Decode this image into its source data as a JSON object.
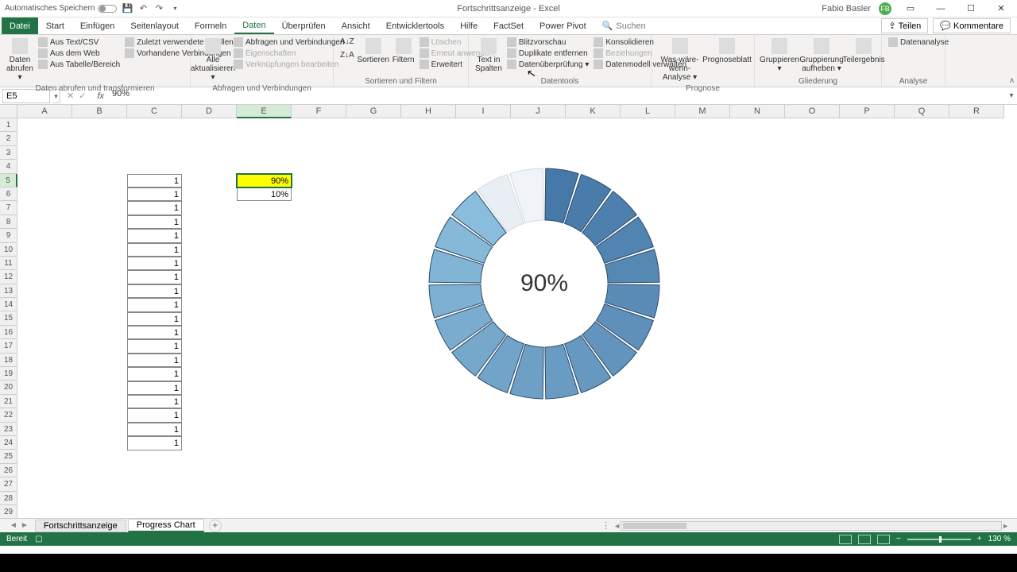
{
  "app": {
    "autosave_label": "Automatisches Speichern",
    "title": "Fortschrittsanzeige  -  Excel",
    "user_name": "Fabio Basler",
    "user_initials": "FB"
  },
  "tabs": {
    "file": "Datei",
    "items": [
      "Start",
      "Einfügen",
      "Seitenlayout",
      "Formeln",
      "Daten",
      "Überprüfen",
      "Ansicht",
      "Entwicklertools",
      "Hilfe",
      "FactSet",
      "Power Pivot"
    ],
    "active": "Daten",
    "search_placeholder": "Suchen",
    "share": "Teilen",
    "comments": "Kommentare"
  },
  "ribbon": {
    "g1": {
      "big": "Daten abrufen ▾",
      "items": [
        "Aus Text/CSV",
        "Aus dem Web",
        "Aus Tabelle/Bereich",
        "Zuletzt verwendete Quellen",
        "Vorhandene Verbindungen"
      ],
      "label": "Daten abrufen und transformieren"
    },
    "g2": {
      "big": "Alle aktualisieren ▾",
      "items": [
        "Abfragen und Verbindungen",
        "Eigenschaften",
        "Verknüpfungen bearbeiten"
      ],
      "label": "Abfragen und Verbindungen"
    },
    "g3": {
      "sortAZ": "A↓Z",
      "sortZA": "Z↓A",
      "sort": "Sortieren",
      "filter": "Filtern",
      "items": [
        "Löschen",
        "Erneut anwenden",
        "Erweitert"
      ],
      "label": "Sortieren und Filtern"
    },
    "g4": {
      "big": "Text in Spalten",
      "items": [
        "Blitzvorschau",
        "Duplikate entfernen",
        "Datenüberprüfung ▾",
        "Konsolidieren",
        "Beziehungen",
        "Datenmodell verwalten"
      ],
      "label": "Datentools"
    },
    "g5": {
      "big1": "Was-wäre-wenn-Analyse ▾",
      "big2": "Prognoseblatt",
      "label": "Prognose"
    },
    "g6": {
      "big1": "Gruppieren ▾",
      "big2": "Gruppierung aufheben ▾",
      "big3": "Teilergebnis",
      "label": "Gliederung"
    },
    "g7": {
      "item": "Datenanalyse",
      "label": "Analyse"
    }
  },
  "namebox": "E5",
  "formula": "90%",
  "columns": [
    "A",
    "B",
    "C",
    "D",
    "E",
    "F",
    "G",
    "H",
    "I",
    "J",
    "K",
    "L",
    "M",
    "N",
    "O",
    "P",
    "Q",
    "R"
  ],
  "rows": 29,
  "selected": {
    "col": "E",
    "row": 5
  },
  "data_c": [
    "1",
    "1",
    "1",
    "1",
    "1",
    "1",
    "1",
    "1",
    "1",
    "1",
    "1",
    "1",
    "1",
    "1",
    "1",
    "1",
    "1",
    "1",
    "1",
    "1"
  ],
  "data_e": {
    "5": "90%",
    "6": "10%"
  },
  "chart_data": {
    "type": "pie",
    "title": "",
    "center_label": "90%",
    "series": [
      {
        "name": "segments",
        "values": [
          1,
          1,
          1,
          1,
          1,
          1,
          1,
          1,
          1,
          1,
          1,
          1,
          1,
          1,
          1,
          1,
          1,
          1,
          1,
          1
        ]
      }
    ],
    "progress_percent": 90,
    "remaining_percent": 10,
    "colors_filled": [
      "#4678a8",
      "#4a7cab",
      "#4e80ae",
      "#5284b1",
      "#5688b4",
      "#5a8cb7",
      "#5e90ba",
      "#6294bd",
      "#6698c0",
      "#6a9cc3",
      "#6ea0c6",
      "#72a4c9",
      "#76a8cc",
      "#7aaccf",
      "#7eb0d2",
      "#82b4d5",
      "#86b8d8",
      "#8abcdb"
    ],
    "colors_empty": [
      "#e8eef4",
      "#f0f4f8"
    ]
  },
  "sheets": {
    "items": [
      "Fortschrittsanzeige",
      "Progress Chart"
    ],
    "active": "Progress Chart"
  },
  "status": {
    "ready": "Bereit",
    "zoom": "130 %"
  }
}
